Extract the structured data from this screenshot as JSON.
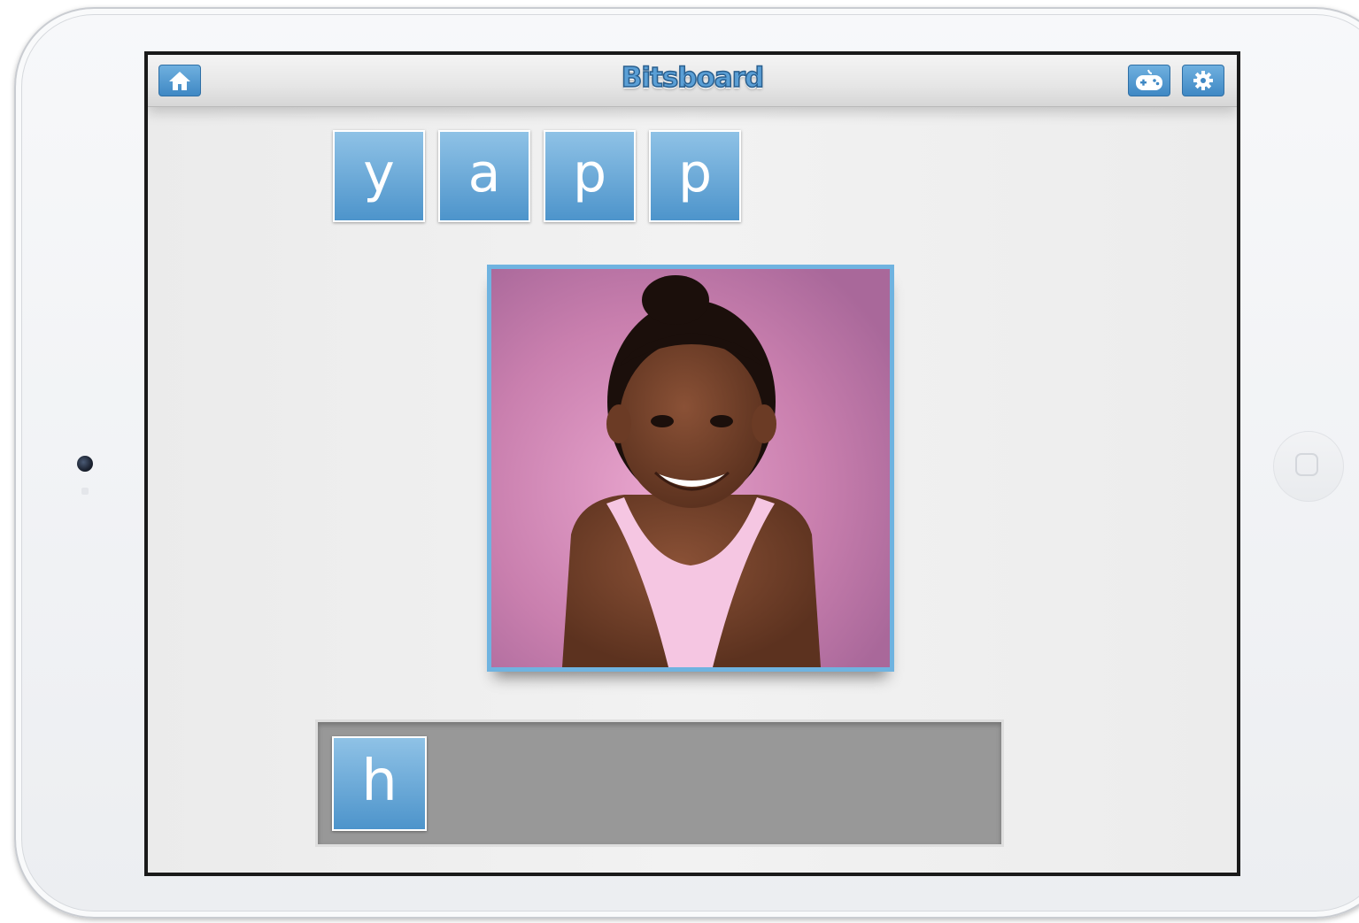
{
  "app": {
    "brand": "Bitsboard"
  },
  "toolbar": {
    "home_icon": "home-icon",
    "games_icon": "gamepad-icon",
    "settings_icon": "gear-icon"
  },
  "puzzle": {
    "scrambled_letters": [
      "y",
      "a",
      "p",
      "p"
    ],
    "answer_letters": [
      "h"
    ]
  },
  "colors": {
    "tile_blue": "#4d94cb",
    "tile_blue_light": "#8fc2e6",
    "frame_blue": "#6fb3e0",
    "tray_gray": "#989898",
    "photo_background": "#c97fae"
  }
}
